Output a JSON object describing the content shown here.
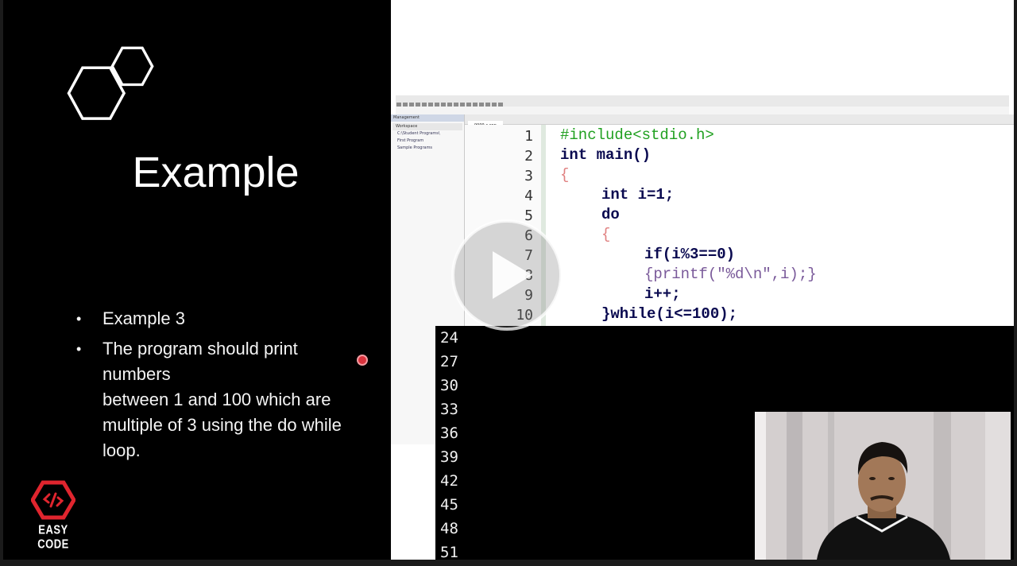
{
  "slide": {
    "title": "Example",
    "bullets": [
      "Example 3",
      "The program should print numbers\nbetween 1 and 100 which are multiple of 3 using the do while loop."
    ],
    "brand": "EASY CODE"
  },
  "ide": {
    "management_title": "Management",
    "management_tab": "Workspace",
    "tree": [
      "C:\\Student Programs\\",
      "First Program",
      "Sample Programs"
    ],
    "file_tab": "9999.c.cpp",
    "line_numbers": [
      "1",
      "2",
      "3",
      "4",
      "5",
      "6",
      "7",
      "8",
      "9",
      "10"
    ],
    "code": [
      "#include<stdio.h>",
      "int main()",
      "{",
      "int i=1;",
      "do",
      "{",
      "if(i%3==0)",
      "{printf(\"%d\\n\",i);}",
      "i++;",
      "}while(i<=100);"
    ]
  },
  "console": {
    "lines": [
      "24",
      "27",
      "30",
      "33",
      "36",
      "39",
      "42",
      "45",
      "48",
      "51"
    ]
  },
  "colors": {
    "background": "#000000",
    "keyword": "#0a0a50",
    "preprocessor": "#20a020",
    "brand_red": "#e0252e"
  }
}
